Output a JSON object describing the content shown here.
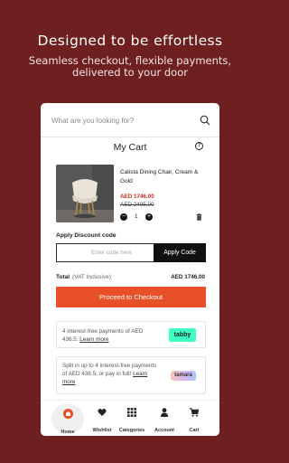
{
  "hero": {
    "title": "Designed to be effortless",
    "subtitle": "Seamless checkout, flexible payments, delivered to your door"
  },
  "search": {
    "placeholder": "What are you looking for?"
  },
  "cart": {
    "title": "My Cart",
    "item": {
      "name": "Calista Dining Chair, Cream & Gold",
      "price": "AED 1746.00",
      "old_price": "AED 2495.00",
      "quantity": "1"
    },
    "discount": {
      "label": "Apply Discount code",
      "placeholder": "Enter code here",
      "button": "Apply Code"
    },
    "total": {
      "label": "Total",
      "note": "(VAT Inclusive)",
      "value": "AED 1746.00"
    },
    "checkout_button": "Proceed to Checkout"
  },
  "promos": {
    "tabby": {
      "text": "4 interest-free payments of AED 436.5.",
      "link": "Learn more",
      "logo": "tabby"
    },
    "tamara": {
      "text": "Split in up to 4 interest-free payments of AED 436.5, or pay in full!",
      "link": "Learn more",
      "logo": "tamara"
    }
  },
  "nav": {
    "items": [
      {
        "label": "Home",
        "icon": "home-icon",
        "active": true
      },
      {
        "label": "Wishlist",
        "icon": "heart-icon"
      },
      {
        "label": "Categories",
        "icon": "grid-icon"
      },
      {
        "label": "Account",
        "icon": "user-icon"
      },
      {
        "label": "Cart",
        "icon": "cart-icon"
      }
    ]
  },
  "colors": {
    "background": "#6e1f1f",
    "accent": "#e8502a",
    "sale_price": "#d02a1f",
    "tabby": "#3effc4"
  }
}
